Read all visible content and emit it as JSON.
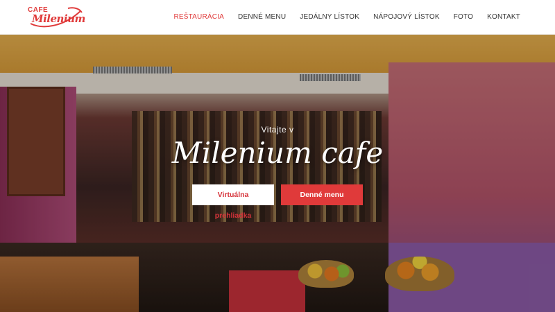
{
  "logo": {
    "line1": "CAFE",
    "line2": "Milenium"
  },
  "nav": {
    "items": [
      {
        "label": "REŠTAURÁCIA",
        "active": true
      },
      {
        "label": "DENNÉ MENU",
        "active": false
      },
      {
        "label": "JEDÁLNY LÍSTOK",
        "active": false
      },
      {
        "label": "NÁPOJOVÝ LÍSTOK",
        "active": false
      },
      {
        "label": "FOTO",
        "active": false
      },
      {
        "label": "KONTAKT",
        "active": false
      }
    ]
  },
  "hero": {
    "welcome": "Vitajte v",
    "title": "Milenium cafe",
    "primary_button": "Virtuálna prehliadka",
    "secondary_button": "Denné menu"
  },
  "colors": {
    "accent": "#e03a3a",
    "header_bg": "#ffffff"
  }
}
